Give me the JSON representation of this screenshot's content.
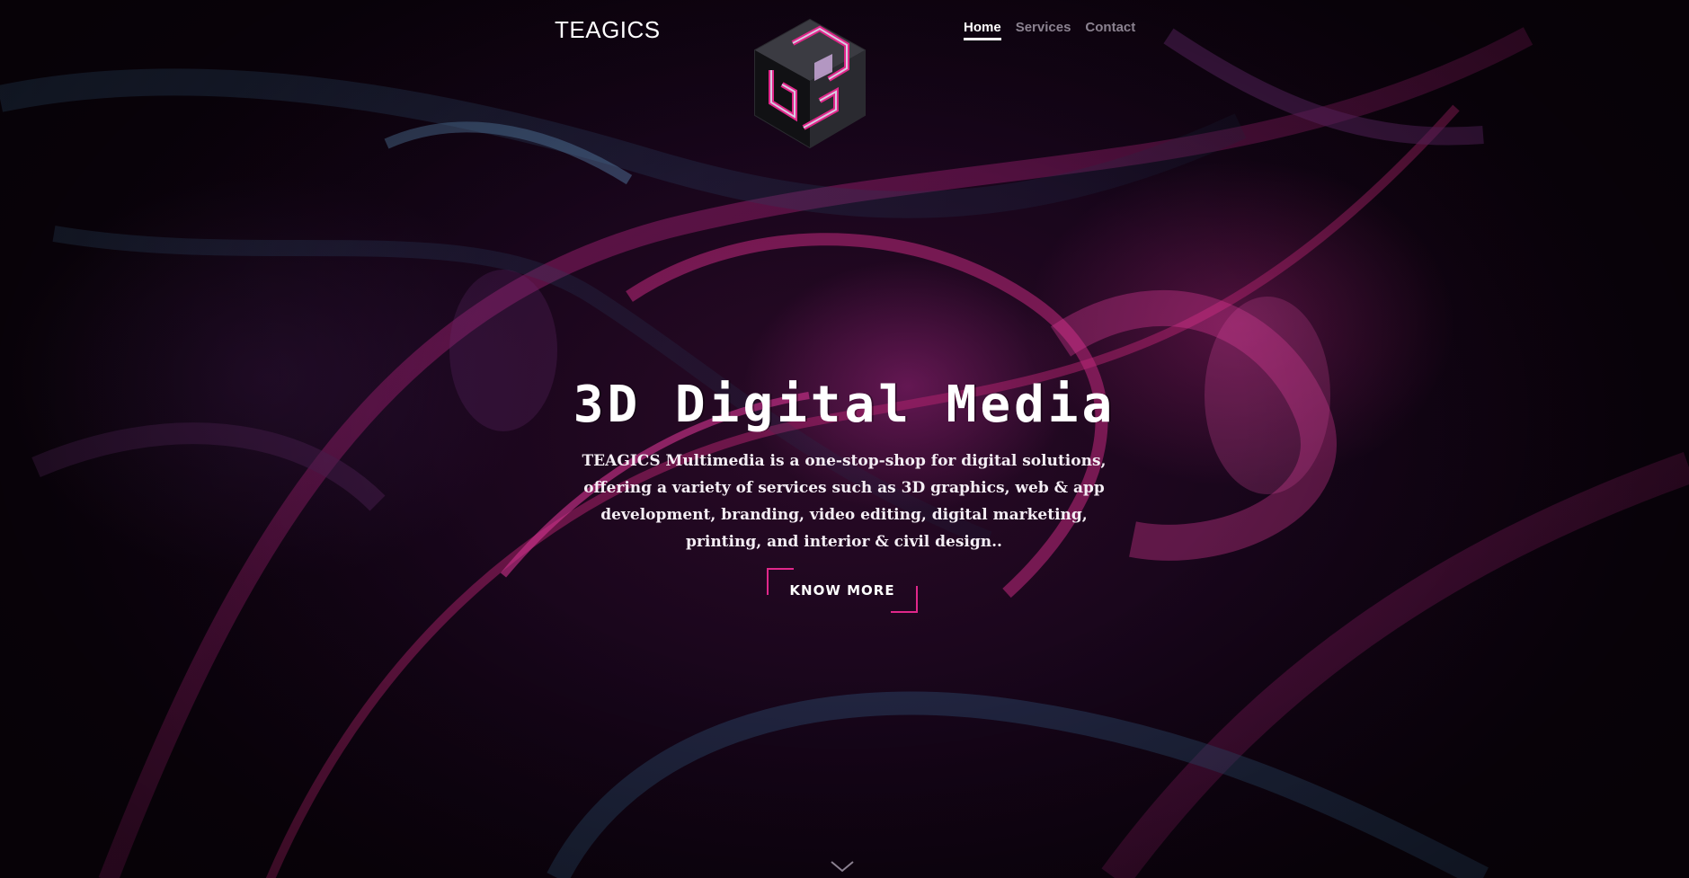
{
  "header": {
    "brand": "TEAGICS",
    "logo_icon": "teagics-cube-logo",
    "nav": [
      {
        "label": "Home",
        "active": true
      },
      {
        "label": "Services",
        "active": false
      },
      {
        "label": "Contact",
        "active": false
      }
    ]
  },
  "hero": {
    "title": "3D Digital Media",
    "description": "TEAGICS Multimedia is a one-stop-shop for digital solutions, offering a variety of services such as 3D graphics, web & app development, branding, video editing, digital marketing, printing, and interior & civil design..",
    "cta_label": "KNOW MORE",
    "scroll_icon": "chevron-down-icon"
  },
  "colors": {
    "accent": "#e0278a",
    "background": "#120411",
    "nav_inactive": "#8b8290"
  }
}
